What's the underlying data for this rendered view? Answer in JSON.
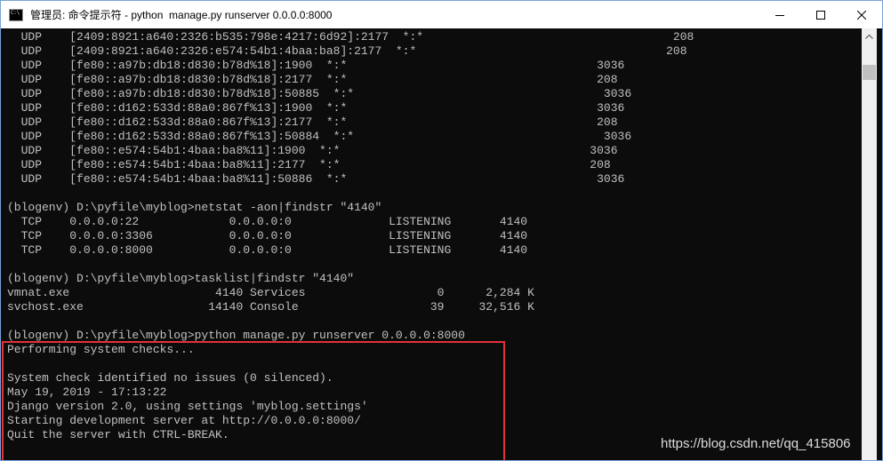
{
  "window": {
    "title": "管理员: 命令提示符 - python  manage.py runserver 0.0.0.0:8000",
    "icon_text": "C:\\"
  },
  "console": {
    "lines": [
      "  UDP    [2409:8921:a640:2326:b535:798e:4217:6d92]:2177  *:*                                    208",
      "  UDP    [2409:8921:a640:2326:e574:54b1:4baa:ba8]:2177  *:*                                    208",
      "  UDP    [fe80::a97b:db18:d830:b78d%18]:1900  *:*                                    3036",
      "  UDP    [fe80::a97b:db18:d830:b78d%18]:2177  *:*                                    208",
      "  UDP    [fe80::a97b:db18:d830:b78d%18]:50885  *:*                                    3036",
      "  UDP    [fe80::d162:533d:88a0:867f%13]:1900  *:*                                    3036",
      "  UDP    [fe80::d162:533d:88a0:867f%13]:2177  *:*                                    208",
      "  UDP    [fe80::d162:533d:88a0:867f%13]:50884  *:*                                    3036",
      "  UDP    [fe80::e574:54b1:4baa:ba8%11]:1900  *:*                                    3036",
      "  UDP    [fe80::e574:54b1:4baa:ba8%11]:2177  *:*                                    208",
      "  UDP    [fe80::e574:54b1:4baa:ba8%11]:50886  *:*                                    3036",
      "",
      "(blogenv) D:\\pyfile\\myblog>netstat -aon|findstr \"4140\"",
      "  TCP    0.0.0.0:22             0.0.0.0:0              LISTENING       4140",
      "  TCP    0.0.0.0:3306           0.0.0.0:0              LISTENING       4140",
      "  TCP    0.0.0.0:8000           0.0.0.0:0              LISTENING       4140",
      "",
      "(blogenv) D:\\pyfile\\myblog>tasklist|findstr \"4140\"",
      "vmnat.exe                     4140 Services                   0      2,284 K",
      "svchost.exe                  14140 Console                   39     32,516 K",
      "",
      "(blogenv) D:\\pyfile\\myblog>python manage.py runserver 0.0.0.0:8000",
      "Performing system checks...",
      "",
      "System check identified no issues (0 silenced).",
      "May 19, 2019 - 17:13:22",
      "Django version 2.0, using settings 'myblog.settings'",
      "Starting development server at http://0.0.0.0:8000/",
      "Quit the server with CTRL-BREAK."
    ]
  },
  "watermark": "https://blog.csdn.net/qq_415806",
  "colors": {
    "console_bg": "#0c0c0c",
    "console_fg": "#c0c0c0",
    "highlight_border": "#e2323a"
  }
}
